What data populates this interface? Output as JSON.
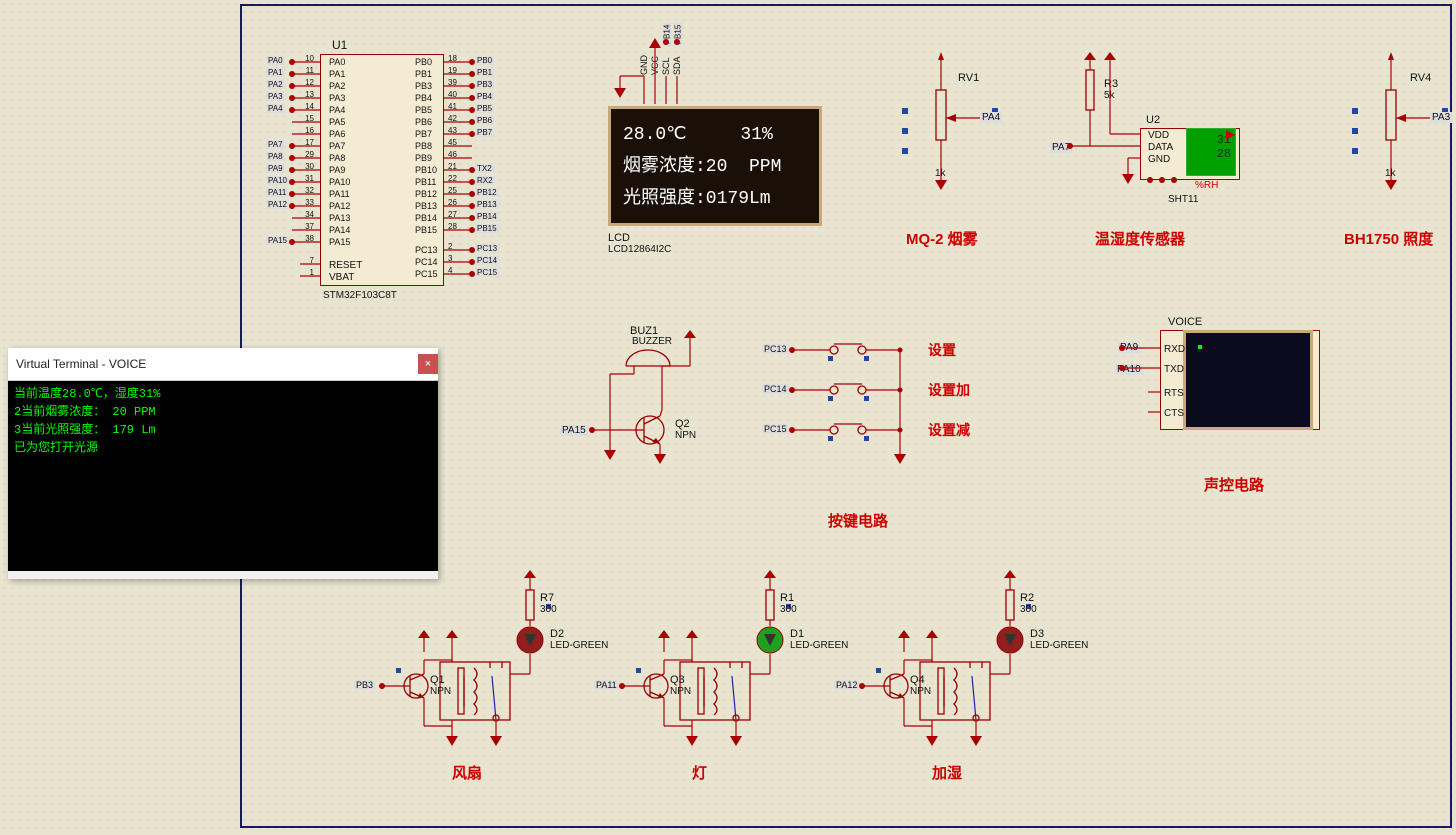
{
  "terminal": {
    "title": "Virtual Terminal - VOICE",
    "close": "×",
    "lines": [
      "当前温度28.0℃，湿度31%",
      "2当前烟雾浓度： 20 PPM",
      "3当前光照强度： 179 Lm",
      "已为您打开光源"
    ]
  },
  "lcd": {
    "ref": "LCD",
    "part": "LCD12864I2C",
    "row1": "28.0℃     31%",
    "row2": "烟雾浓度:20  PPM",
    "row3": "光照强度:0179Lm",
    "pins": [
      "GND",
      "VCC",
      "SCL",
      "SDA"
    ],
    "nets": [
      "PB14",
      "PB15"
    ]
  },
  "mcu": {
    "ref": "U1",
    "part": "STM32F103C8T",
    "left_pins": [
      {
        "n": "10",
        "sig": "PA0",
        "lbl": "PA0"
      },
      {
        "n": "11",
        "sig": "PA1",
        "lbl": "PA1"
      },
      {
        "n": "12",
        "sig": "PA2",
        "lbl": "PA2"
      },
      {
        "n": "13",
        "sig": "PA3",
        "lbl": "PA3"
      },
      {
        "n": "14",
        "sig": "PA4",
        "lbl": "PA4"
      },
      {
        "n": "15",
        "sig": "PA5",
        "lbl": ""
      },
      {
        "n": "16",
        "sig": "PA6",
        "lbl": ""
      },
      {
        "n": "17",
        "sig": "PA7",
        "lbl": "PA7"
      },
      {
        "n": "29",
        "sig": "PA8",
        "lbl": "PA8"
      },
      {
        "n": "30",
        "sig": "PA9",
        "lbl": "PA9"
      },
      {
        "n": "31",
        "sig": "PA10",
        "lbl": "PA10"
      },
      {
        "n": "32",
        "sig": "PA11",
        "lbl": "PA11"
      },
      {
        "n": "33",
        "sig": "PA12",
        "lbl": "PA12"
      },
      {
        "n": "34",
        "sig": "PA13",
        "lbl": ""
      },
      {
        "n": "37",
        "sig": "PA14",
        "lbl": ""
      },
      {
        "n": "38",
        "sig": "PA15",
        "lbl": "PA15"
      }
    ],
    "right_pins": [
      {
        "n": "18",
        "sig": "PB0",
        "lbl": "PB0"
      },
      {
        "n": "19",
        "sig": "PB1",
        "lbl": "PB1"
      },
      {
        "n": "39",
        "sig": "PB3",
        "lbl": "PB3"
      },
      {
        "n": "40",
        "sig": "PB4",
        "lbl": "PB4"
      },
      {
        "n": "41",
        "sig": "PB5",
        "lbl": "PB5"
      },
      {
        "n": "42",
        "sig": "PB6",
        "lbl": "PB6"
      },
      {
        "n": "43",
        "sig": "PB7",
        "lbl": "PB7"
      },
      {
        "n": "45",
        "sig": "PB8",
        "lbl": ""
      },
      {
        "n": "46",
        "sig": "PB9",
        "lbl": ""
      },
      {
        "n": "21",
        "sig": "PB10",
        "lbl": "TX2"
      },
      {
        "n": "22",
        "sig": "PB11",
        "lbl": "RX2"
      },
      {
        "n": "25",
        "sig": "PB12",
        "lbl": "PB12"
      },
      {
        "n": "26",
        "sig": "PB13",
        "lbl": "PB13"
      },
      {
        "n": "27",
        "sig": "PB14",
        "lbl": "PB14"
      },
      {
        "n": "28",
        "sig": "PB15",
        "lbl": "PB15"
      }
    ],
    "right_pc": [
      {
        "n": "2",
        "sig": "PC13",
        "lbl": "PC13"
      },
      {
        "n": "3",
        "sig": "PC14",
        "lbl": "PC14"
      },
      {
        "n": "4",
        "sig": "PC15",
        "lbl": "PC15"
      }
    ],
    "left_bottom": [
      {
        "n": "7",
        "sig": "RESET"
      },
      {
        "n": "1",
        "sig": "VBAT"
      }
    ]
  },
  "sensors": {
    "mq2": {
      "title": "MQ-2 烟雾",
      "ref": "RV1",
      "val": "1k",
      "net": "PA4"
    },
    "dht": {
      "title": "温湿度传感器",
      "ref_r": "R3",
      "r_val": "5k",
      "ref_u": "U2",
      "part": "SHT11",
      "temp": "31",
      "hum": "28",
      "nets": [
        "PA7"
      ],
      "pins_u2": [
        "VDD",
        "DATA",
        "GND"
      ],
      "rh": "%RH",
      "badge": "◎"
    },
    "bh1750": {
      "title": "BH1750 照度",
      "ref": "RV4",
      "val": "1k",
      "net": "PA3"
    }
  },
  "buzzer": {
    "ref": "BUZ1",
    "part": "BUZZER",
    "q_ref": "Q2",
    "q_part": "NPN",
    "net": "PA15"
  },
  "buttons": {
    "title": "按键电路",
    "items": [
      {
        "net": "PC13",
        "label": "设置"
      },
      {
        "net": "PC14",
        "label": "设置加"
      },
      {
        "net": "PC15",
        "label": "设置减"
      }
    ]
  },
  "voice": {
    "title": "声控电路",
    "ref": "VOICE",
    "pins": [
      "RXD",
      "TXD",
      "RTS",
      "CTS"
    ],
    "nets": [
      "PA9",
      "PA10"
    ]
  },
  "relays": [
    {
      "title": "风扇",
      "r_ref": "R7",
      "r_val": "300",
      "d_ref": "D2",
      "d_part": "LED-GREEN",
      "q_ref": "Q1",
      "q_part": "NPN",
      "net": "PB3",
      "led_color": "#902020"
    },
    {
      "title": "灯",
      "r_ref": "R1",
      "r_val": "300",
      "d_ref": "D1",
      "d_part": "LED-GREEN",
      "q_ref": "Q3",
      "q_part": "NPN",
      "net": "PA11",
      "led_color": "#20A020"
    },
    {
      "title": "加湿",
      "r_ref": "R2",
      "r_val": "300",
      "d_ref": "D3",
      "d_part": "LED-GREEN",
      "q_ref": "Q4",
      "q_part": "NPN",
      "net": "PA12",
      "led_color": "#902020"
    }
  ]
}
